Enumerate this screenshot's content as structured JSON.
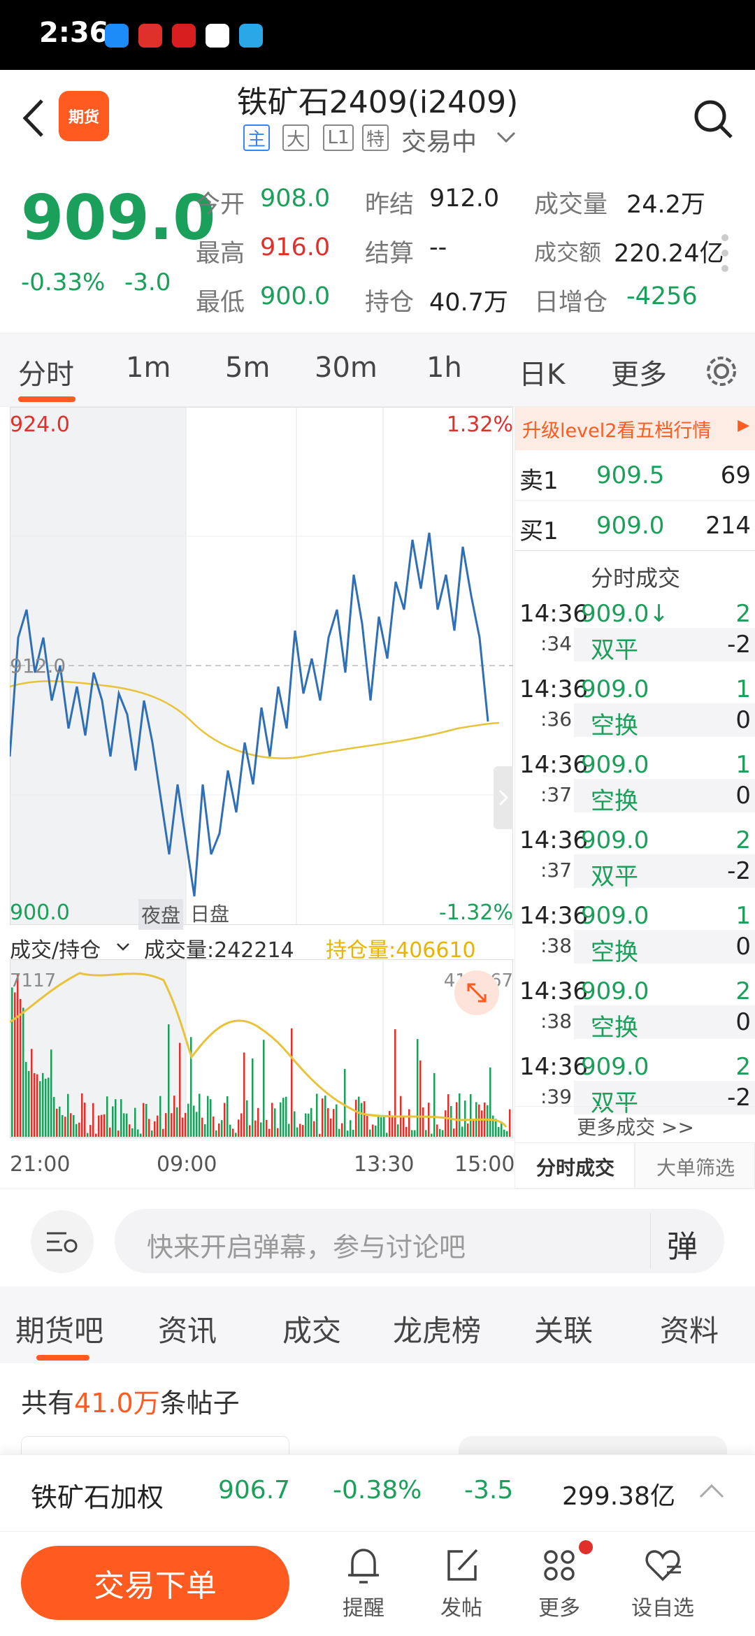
{
  "status": {
    "time": "2:36"
  },
  "header": {
    "title": "铁矿石2409(i2409)",
    "badge": "期货",
    "tags": [
      "主",
      "大",
      "L1",
      "特"
    ],
    "state": "交易中"
  },
  "quote": {
    "price": "909.0",
    "change_pct": "-0.33%",
    "change": "-3.0",
    "fields": [
      {
        "label": "今开",
        "value": "908.0",
        "color": "green"
      },
      {
        "label": "昨结",
        "value": "912.0",
        "color": "black"
      },
      {
        "label": "成交量",
        "value": "24.2万",
        "color": "black"
      },
      {
        "label": "最高",
        "value": "916.0",
        "color": "red"
      },
      {
        "label": "结算",
        "value": "--",
        "color": "black"
      },
      {
        "label": "成交额",
        "value": "220.24亿",
        "color": "black"
      },
      {
        "label": "最低",
        "value": "900.0",
        "color": "green"
      },
      {
        "label": "持仓",
        "value": "40.7万",
        "color": "black"
      },
      {
        "label": "日增仓",
        "value": "-4256",
        "color": "green"
      }
    ]
  },
  "tabs": [
    "分时",
    "1m",
    "5m",
    "30m",
    "1h",
    "日K",
    "更多"
  ],
  "chart": {
    "max_label": "924.0",
    "min_label": "900.0",
    "mid_label": "912.0",
    "max_pct": "1.32%",
    "min_pct": "-1.32%",
    "night_label": "夜盘",
    "day_label": "日盘",
    "vol_selector": "成交/持仓",
    "vol_text": "成交量:242214",
    "oi_text": "持仓量:406610",
    "vol_left": "7117",
    "vol_right": "413267",
    "times": [
      "21:00",
      "09:00",
      "13:30",
      "15:00"
    ]
  },
  "chart_data": {
    "type": "line",
    "x": [
      "21:00",
      "09:00",
      "13:30",
      "15:00"
    ],
    "ylim": [
      900.0,
      924.0
    ],
    "series": [],
    "reference": 912.0,
    "volume_axis_max": 7117,
    "oi_axis_max": 413267,
    "total_volume": 242214,
    "open_interest": 406610
  },
  "book": {
    "banner": "升级level2看五档行情",
    "sell": {
      "label": "卖1",
      "price": "909.5",
      "qty": "69"
    },
    "buy": {
      "label": "买1",
      "price": "909.0",
      "qty": "214"
    },
    "ticks_title": "分时成交",
    "ticks": [
      {
        "time": "14:36",
        "sec": ":34",
        "price": "909.0↓",
        "qty": "2",
        "type": "双平",
        "oi": "-2"
      },
      {
        "time": "14:36",
        "sec": ":36",
        "price": "909.0",
        "qty": "1",
        "type": "空换",
        "oi": "0"
      },
      {
        "time": "14:36",
        "sec": ":37",
        "price": "909.0",
        "qty": "1",
        "type": "空换",
        "oi": "0"
      },
      {
        "time": "14:36",
        "sec": ":37",
        "price": "909.0",
        "qty": "2",
        "type": "双平",
        "oi": "-2"
      },
      {
        "time": "14:36",
        "sec": ":38",
        "price": "909.0",
        "qty": "1",
        "type": "空换",
        "oi": "0"
      },
      {
        "time": "14:36",
        "sec": ":38",
        "price": "909.0",
        "qty": "2",
        "type": "空换",
        "oi": "0"
      },
      {
        "time": "14:36",
        "sec": ":39",
        "price": "909.0",
        "qty": "2",
        "type": "双平",
        "oi": "-2"
      }
    ],
    "more": "更多成交 >>",
    "tab_ticks": "分时成交",
    "tab_big": "大单筛选"
  },
  "comment": {
    "placeholder": "快来开启弹幕，参与讨论吧",
    "danmu": "弹"
  },
  "sectabs": [
    "期货吧",
    "资讯",
    "成交",
    "龙虎榜",
    "关联",
    "资料"
  ],
  "posts": {
    "prefix": "共有",
    "count": "41.0万",
    "suffix": "条帖子"
  },
  "index": {
    "name": "铁矿石加权",
    "price": "906.7",
    "pct": "-0.38%",
    "change": "-3.5",
    "amount": "299.38亿"
  },
  "bottom": {
    "trade": "交易下单",
    "items": [
      "提醒",
      "发帖",
      "更多",
      "设自选"
    ]
  }
}
